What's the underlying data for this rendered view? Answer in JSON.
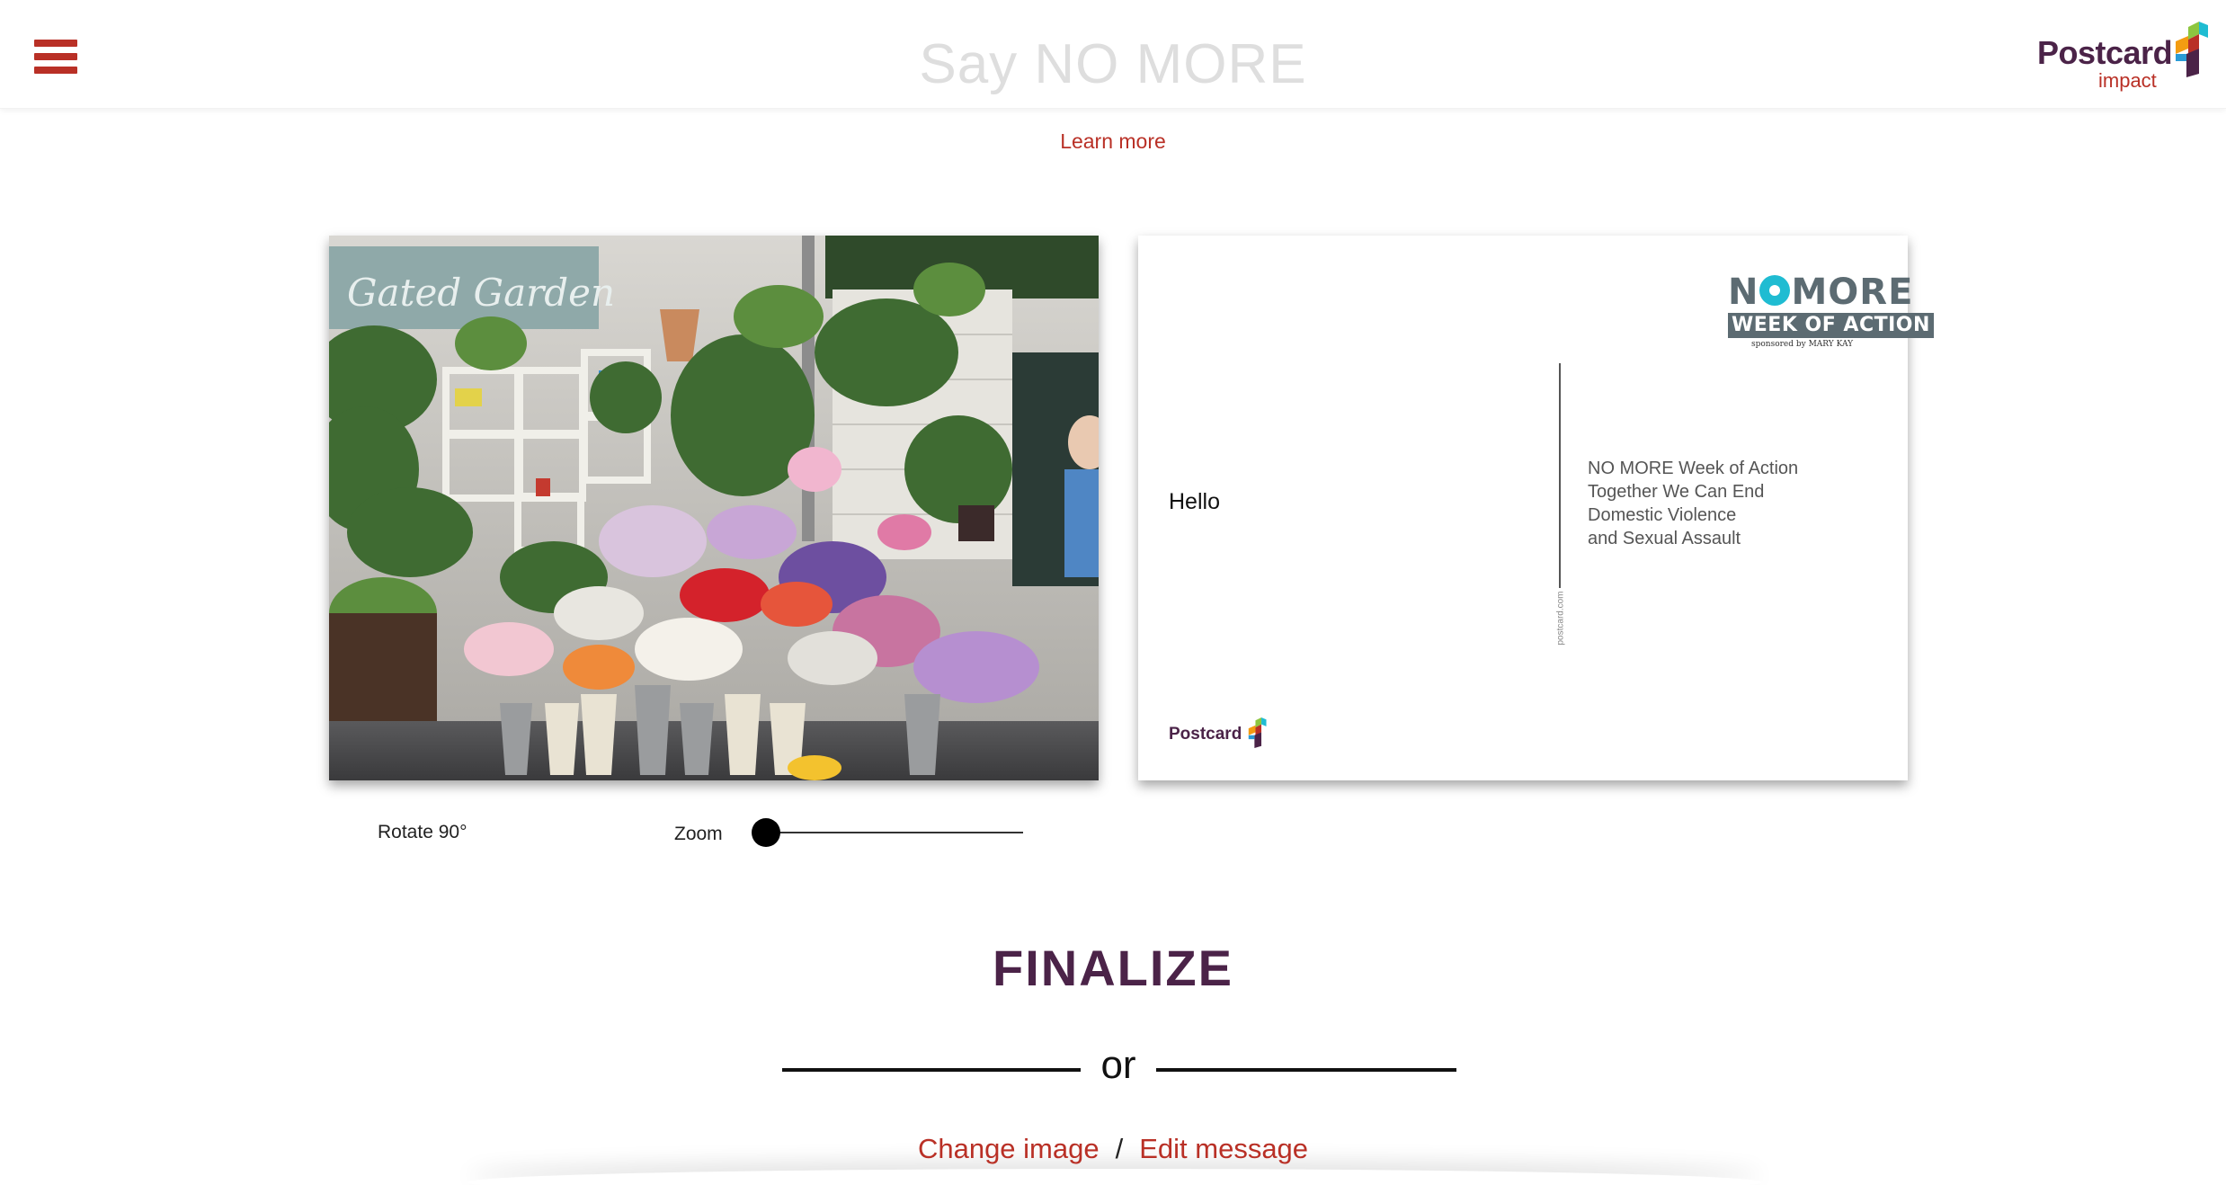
{
  "header": {
    "menu_icon": "hamburger-menu-icon",
    "title": "Say NO MORE",
    "brand_name": "Postcard",
    "brand_sub": "impact"
  },
  "learn_more": "Learn more",
  "card_back": {
    "logo_line1_pre": "N",
    "logo_line1_post": "MORE",
    "logo_line2": "WEEK OF ACTION",
    "logo_line3": "sponsored by MARY KAY",
    "greeting": "Hello",
    "address_lines": [
      "NO MORE Week of Action",
      "Together We Can End",
      "Domestic Violence",
      "and Sexual Assault"
    ],
    "vertical_text": "postcard.com",
    "footer_brand": "Postcard"
  },
  "card_front": {
    "sign_text": "Gated Garden"
  },
  "controls": {
    "rotate": "Rotate 90°",
    "zoom_label": "Zoom",
    "zoom_level": 0
  },
  "finalize": "FINALIZE",
  "or": "or",
  "links": {
    "change_image": "Change image",
    "separator": "/",
    "edit_message": "Edit message"
  },
  "colors": {
    "accent_red": "#b93026",
    "brand_purple": "#4b2348",
    "nomore_teal": "#1fbcd2",
    "nomore_gray": "#5c6b72"
  }
}
